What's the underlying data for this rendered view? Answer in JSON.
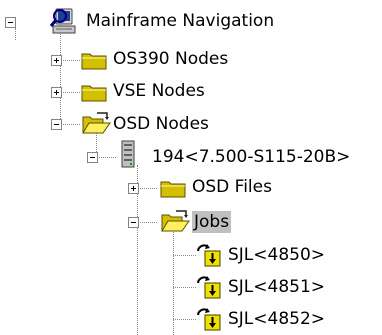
{
  "tree": {
    "root": {
      "label": "Mainframe Navigation",
      "icon": "mainframe-navigation-icon",
      "expanded": true
    },
    "nodes": [
      {
        "label": "OS390 Nodes",
        "icon": "folder-closed-icon",
        "expanded": false
      },
      {
        "label": "VSE Nodes",
        "icon": "folder-closed-icon",
        "expanded": false
      },
      {
        "label": "OSD Nodes",
        "icon": "folder-open-icon",
        "expanded": true
      }
    ],
    "host": {
      "label": "194<7.500-S115-20B>",
      "icon": "host-computer-icon",
      "expanded": true
    },
    "host_children": [
      {
        "label": "OSD Files",
        "icon": "folder-closed-icon",
        "expanded": false
      },
      {
        "label": "Jobs",
        "icon": "folder-open-icon",
        "expanded": true,
        "selected": true
      }
    ],
    "jobs": [
      {
        "label": "SJL<4850>",
        "icon": "job-download-icon"
      },
      {
        "label": "SJL<4851>",
        "icon": "job-download-icon"
      },
      {
        "label": "SJL<4852>",
        "icon": "job-download-icon"
      }
    ]
  }
}
